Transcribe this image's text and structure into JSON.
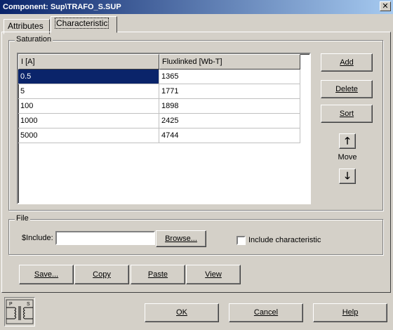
{
  "window": {
    "title": "Component: Sup\\TRAFO_S.SUP",
    "close_glyph": "✕"
  },
  "tabs": [
    {
      "label": "Attributes",
      "active": false
    },
    {
      "label": "Characteristic",
      "active": true
    }
  ],
  "saturation": {
    "group_label": "Saturation",
    "columns": [
      "I [A]",
      "Fluxlinked [Wb-T]"
    ],
    "rows": [
      {
        "i": "0.5",
        "flux": "1365"
      },
      {
        "i": "5",
        "flux": "1771"
      },
      {
        "i": "100",
        "flux": "1898"
      },
      {
        "i": "1000",
        "flux": "2425"
      },
      {
        "i": "5000",
        "flux": "4744"
      }
    ],
    "selected_row": 0
  },
  "side_buttons": {
    "add": "Add",
    "delete": "Delete",
    "sort": "Sort",
    "move_label": "Move",
    "up_glyph": "🡑",
    "down_glyph": "🡓"
  },
  "file": {
    "group_label": "File",
    "include_label": "$Include:",
    "include_value": "",
    "browse": "Browse...",
    "include_characteristic": "Include characteristic",
    "include_checked": false
  },
  "bottom_buttons": {
    "save": "Save...",
    "copy": "Copy",
    "paste": "Paste",
    "view": "View"
  },
  "dialog_buttons": {
    "ok": "OK",
    "cancel": "Cancel",
    "help": "Help"
  },
  "icon": {
    "name": "ps-transformer-icon",
    "p": "P",
    "s": "S"
  }
}
